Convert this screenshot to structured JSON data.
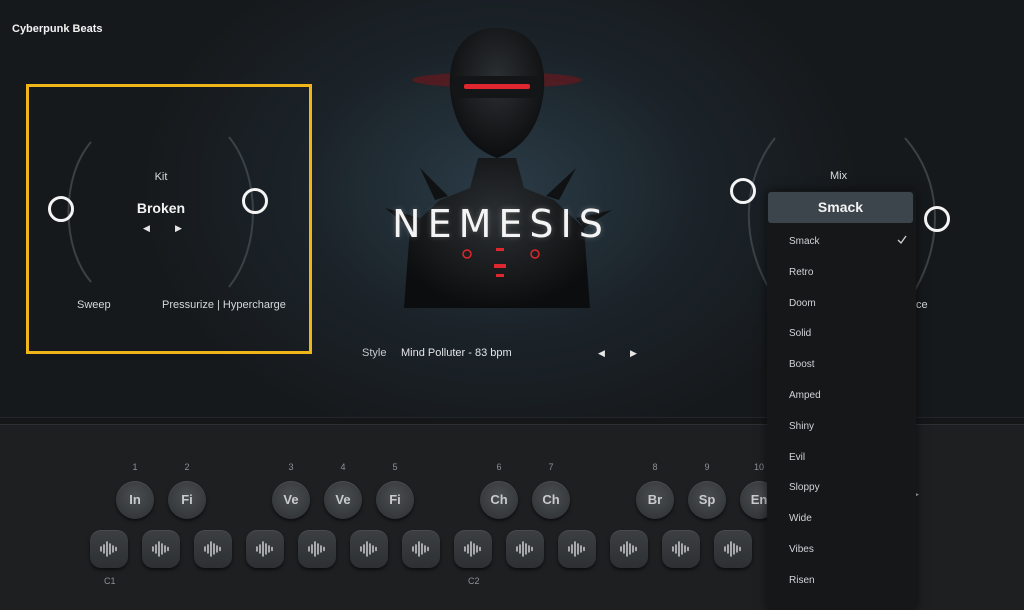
{
  "app": {
    "title": "Cyberpunk Beats"
  },
  "product": {
    "logo_text": "NEMESIS"
  },
  "kit": {
    "label": "Kit",
    "value": "Broken",
    "prev_icon": "chevron-left-icon",
    "next_icon": "chevron-right-icon",
    "left_knob_label": "Sweep",
    "right_knob_label": "Pressurize | Hypercharge",
    "highlight_color": "#f0b619"
  },
  "style": {
    "label": "Style",
    "value": "Mind Polluter - 83 bpm"
  },
  "mix": {
    "label": "Mix",
    "right_knob_label_partial": "ce",
    "selected": "Smack",
    "options": [
      "Smack",
      "Retro",
      "Doom",
      "Solid",
      "Boost",
      "Amped",
      "Shiny",
      "Evil",
      "Sloppy",
      "Wide",
      "Vibes",
      "Risen"
    ],
    "checked_option": "Smack"
  },
  "pads": [
    {
      "num": "1",
      "label": "In"
    },
    {
      "num": "2",
      "label": "Fi"
    },
    {
      "num": "3",
      "label": "Ve"
    },
    {
      "num": "4",
      "label": "Ve"
    },
    {
      "num": "5",
      "label": "Fi"
    },
    {
      "num": "6",
      "label": "Ch"
    },
    {
      "num": "7",
      "label": "Ch"
    },
    {
      "num": "8",
      "label": "Br"
    },
    {
      "num": "9",
      "label": "Sp"
    },
    {
      "num": "10",
      "label": "En"
    }
  ],
  "octaves": [
    "C1",
    "C2"
  ],
  "colors": {
    "accent_red": "#e0262e",
    "panel_bg": "#1d1f21"
  }
}
